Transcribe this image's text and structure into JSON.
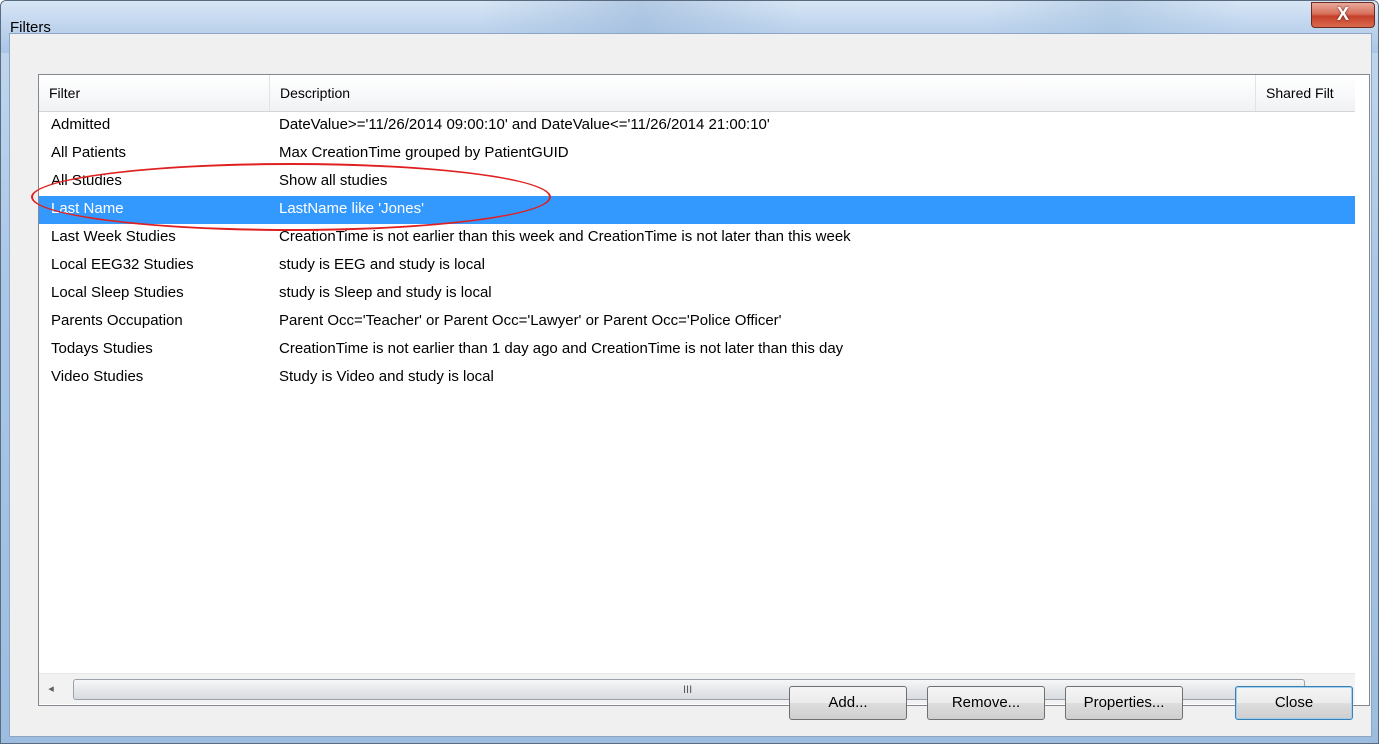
{
  "window": {
    "title": "Filters",
    "close_glyph": "X"
  },
  "columns": [
    "Filter",
    "Description",
    "Shared Filt"
  ],
  "rows": [
    {
      "filter": "Admitted",
      "description": "DateValue>='11/26/2014 09:00:10' and DateValue<='11/26/2014 21:00:10'"
    },
    {
      "filter": "All Patients",
      "description": "Max CreationTime grouped by PatientGUID"
    },
    {
      "filter": "All Studies",
      "description": "Show all studies"
    },
    {
      "filter": "Last Name",
      "description": "LastName like 'Jones'",
      "selected": true
    },
    {
      "filter": "Last Week Studies",
      "description": "CreationTime is not earlier than this week and CreationTime is not later than this week"
    },
    {
      "filter": "Local EEG32 Studies",
      "description": "study is EEG and study is local"
    },
    {
      "filter": "Local Sleep Studies",
      "description": "study is Sleep and study is local"
    },
    {
      "filter": "Parents Occupation",
      "description": "Parent Occ='Teacher' or Parent Occ='Lawyer' or Parent Occ='Police Officer'"
    },
    {
      "filter": "Todays Studies",
      "description": "CreationTime is not earlier than 1 day ago and CreationTime is not later than this day"
    },
    {
      "filter": "Video Studies",
      "description": "Study is Video and study is local"
    }
  ],
  "scrollbar": {
    "left_arrow": "◂",
    "right_arrow": "▸",
    "grip": "III"
  },
  "buttons": {
    "add": "Add...",
    "remove": "Remove...",
    "properties": "Properties...",
    "close": "Close"
  },
  "colors": {
    "selection": "#3399ff",
    "annotation_circle": "#e02020"
  }
}
